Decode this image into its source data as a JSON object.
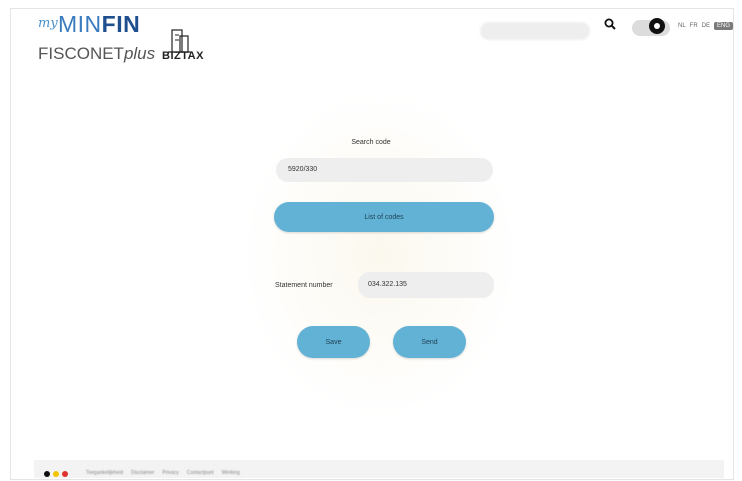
{
  "header": {
    "logo_my": "my",
    "logo_minfin_a": "MIN",
    "logo_minfin_b": "FIN",
    "logo_fisconet_a": "FISCONET",
    "logo_fisconet_b": "plus",
    "biztax_label": "BIZTAX",
    "languages": [
      "NL",
      "FR",
      "DE",
      "ENG"
    ],
    "active_language": "ENG"
  },
  "form": {
    "search_code_label": "Search code",
    "search_code_value": "5920/330",
    "list_button_label": "List of codes",
    "statement_label": "Statement number",
    "statement_value": "034.322.135",
    "save_label": "Save",
    "send_label": "Send"
  },
  "footer": {
    "links": [
      "Toegankelijkheid",
      "Disclaimer",
      "Privacy",
      "Contactpunt",
      "Werking"
    ],
    "dot_colors": [
      "#111111",
      "#f2c500",
      "#e03030"
    ]
  },
  "colors": {
    "accent": "#62b2d5",
    "field_bg": "#eeeeee"
  }
}
